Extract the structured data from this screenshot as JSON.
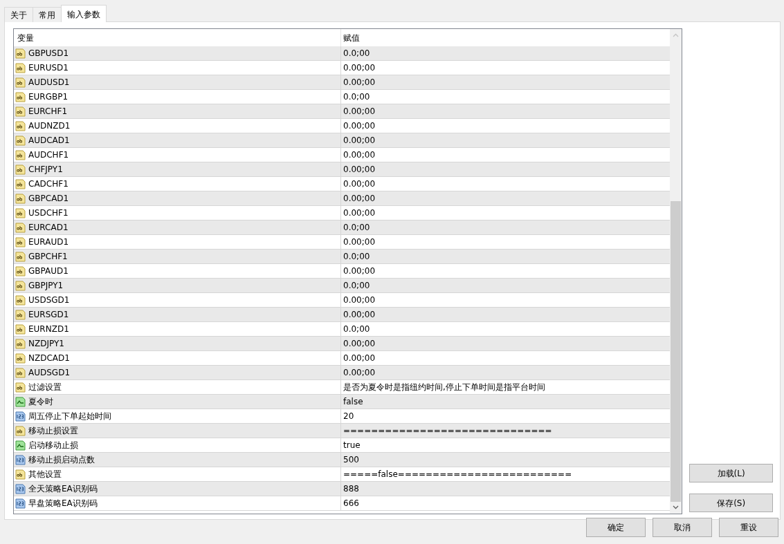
{
  "tabs": [
    {
      "label": "关于",
      "selected": false
    },
    {
      "label": "常用",
      "selected": false
    },
    {
      "label": "输入参数",
      "selected": true
    }
  ],
  "table": {
    "columns": [
      "变量",
      "赋值"
    ],
    "rows": [
      {
        "kind": "string",
        "name": "GBPUSD1",
        "value": "0.0;00"
      },
      {
        "kind": "string",
        "name": "EURUSD1",
        "value": "0.00;00"
      },
      {
        "kind": "string",
        "name": "AUDUSD1",
        "value": "0.00;00"
      },
      {
        "kind": "string",
        "name": "EURGBP1",
        "value": "0.0;00"
      },
      {
        "kind": "string",
        "name": "EURCHF1",
        "value": "0.00;00"
      },
      {
        "kind": "string",
        "name": "AUDNZD1",
        "value": "0.00;00"
      },
      {
        "kind": "string",
        "name": "AUDCAD1",
        "value": "0.00;00"
      },
      {
        "kind": "string",
        "name": "AUDCHF1",
        "value": "0.00;00"
      },
      {
        "kind": "string",
        "name": "CHFJPY1",
        "value": "0.00;00"
      },
      {
        "kind": "string",
        "name": "CADCHF1",
        "value": "0.00;00"
      },
      {
        "kind": "string",
        "name": "GBPCAD1",
        "value": "0.00;00"
      },
      {
        "kind": "string",
        "name": "USDCHF1",
        "value": "0.00;00"
      },
      {
        "kind": "string",
        "name": "EURCAD1",
        "value": "0.0;00"
      },
      {
        "kind": "string",
        "name": "EURAUD1",
        "value": "0.00;00"
      },
      {
        "kind": "string",
        "name": "GBPCHF1",
        "value": "0.0;00"
      },
      {
        "kind": "string",
        "name": "GBPAUD1",
        "value": "0.00;00"
      },
      {
        "kind": "string",
        "name": "GBPJPY1",
        "value": "0.0;00"
      },
      {
        "kind": "string",
        "name": "USDSGD1",
        "value": "0.00;00"
      },
      {
        "kind": "string",
        "name": "EURSGD1",
        "value": "0.00;00"
      },
      {
        "kind": "string",
        "name": "EURNZD1",
        "value": "0.0;00"
      },
      {
        "kind": "string",
        "name": "NZDJPY1",
        "value": "0.00;00"
      },
      {
        "kind": "string",
        "name": "NZDCAD1",
        "value": "0.00;00"
      },
      {
        "kind": "string",
        "name": "AUDSGD1",
        "value": "0.00;00"
      },
      {
        "kind": "string",
        "name": "过滤设置",
        "value": "是否为夏令时是指纽约时间,停止下单时间是指平台时间"
      },
      {
        "kind": "bool",
        "name": "夏令时",
        "value": "false"
      },
      {
        "kind": "int",
        "name": "周五停止下单起始时间",
        "value": "20"
      },
      {
        "kind": "string",
        "name": "移动止损设置",
        "value": "=============================="
      },
      {
        "kind": "bool",
        "name": "启动移动止损",
        "value": "true"
      },
      {
        "kind": "int",
        "name": "移动止损启动点数",
        "value": "500"
      },
      {
        "kind": "string",
        "name": "其他设置",
        "value": "=====false========================="
      },
      {
        "kind": "int",
        "name": "全天策略EA识别码",
        "value": "888"
      },
      {
        "kind": "int",
        "name": "早盘策略EA识别码",
        "value": "666"
      }
    ]
  },
  "side_buttons": [
    "加载(L)",
    "保存(S)"
  ],
  "buttons": [
    "确定",
    "取消",
    "重设"
  ]
}
